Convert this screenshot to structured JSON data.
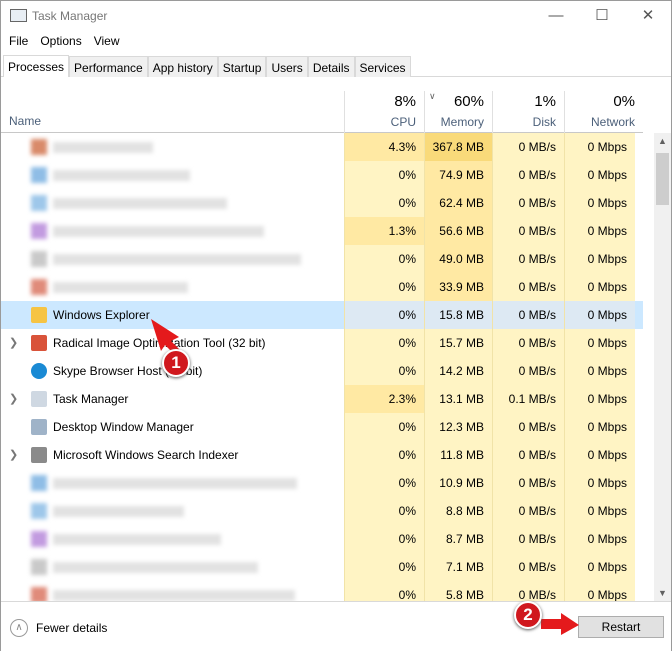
{
  "window": {
    "title": "Task Manager"
  },
  "menu": [
    "File",
    "Options",
    "View"
  ],
  "tabs": [
    "Processes",
    "Performance",
    "App history",
    "Startup",
    "Users",
    "Details",
    "Services"
  ],
  "header": {
    "name": "Name",
    "cpu": {
      "pct": "8%",
      "label": "CPU"
    },
    "memory": {
      "pct": "60%",
      "label": "Memory"
    },
    "disk": {
      "pct": "1%",
      "label": "Disk"
    },
    "network": {
      "pct": "0%",
      "label": "Network"
    }
  },
  "rows": [
    {
      "name": "",
      "cpu": "4.3%",
      "mem": "367.8 MB",
      "disk": "0 MB/s",
      "net": "0 Mbps"
    },
    {
      "name": "",
      "cpu": "0%",
      "mem": "74.9 MB",
      "disk": "0 MB/s",
      "net": "0 Mbps"
    },
    {
      "name": "",
      "cpu": "0%",
      "mem": "62.4 MB",
      "disk": "0 MB/s",
      "net": "0 Mbps"
    },
    {
      "name": "",
      "cpu": "1.3%",
      "mem": "56.6 MB",
      "disk": "0 MB/s",
      "net": "0 Mbps"
    },
    {
      "name": "",
      "cpu": "0%",
      "mem": "49.0 MB",
      "disk": "0 MB/s",
      "net": "0 Mbps"
    },
    {
      "name": "",
      "cpu": "0%",
      "mem": "33.9 MB",
      "disk": "0 MB/s",
      "net": "0 Mbps"
    },
    {
      "name": "Windows Explorer",
      "cpu": "0%",
      "mem": "15.8 MB",
      "disk": "0 MB/s",
      "net": "0 Mbps"
    },
    {
      "name": "Radical Image Optimization Tool (32 bit)",
      "cpu": "0%",
      "mem": "15.7 MB",
      "disk": "0 MB/s",
      "net": "0 Mbps"
    },
    {
      "name": "Skype Browser Host (32 bit)",
      "cpu": "0%",
      "mem": "14.2 MB",
      "disk": "0 MB/s",
      "net": "0 Mbps"
    },
    {
      "name": "Task Manager",
      "cpu": "2.3%",
      "mem": "13.1 MB",
      "disk": "0.1 MB/s",
      "net": "0 Mbps"
    },
    {
      "name": "Desktop Window Manager",
      "cpu": "0%",
      "mem": "12.3 MB",
      "disk": "0 MB/s",
      "net": "0 Mbps"
    },
    {
      "name": "Microsoft Windows Search Indexer",
      "cpu": "0%",
      "mem": "11.8 MB",
      "disk": "0 MB/s",
      "net": "0 Mbps"
    },
    {
      "name": "",
      "cpu": "0%",
      "mem": "10.9 MB",
      "disk": "0 MB/s",
      "net": "0 Mbps"
    },
    {
      "name": "",
      "cpu": "0%",
      "mem": "8.8 MB",
      "disk": "0 MB/s",
      "net": "0 Mbps"
    },
    {
      "name": "",
      "cpu": "0%",
      "mem": "8.7 MB",
      "disk": "0 MB/s",
      "net": "0 Mbps"
    },
    {
      "name": "",
      "cpu": "0%",
      "mem": "7.1 MB",
      "disk": "0 MB/s",
      "net": "0 Mbps"
    },
    {
      "name": "",
      "cpu": "0%",
      "mem": "5.8 MB",
      "disk": "0 MB/s",
      "net": "0 Mbps"
    }
  ],
  "footer": {
    "fewer_details": "Fewer details",
    "restart": "Restart"
  },
  "annotations": [
    "1",
    "2"
  ],
  "colors": {
    "selected_row": "#cce8ff",
    "heat_low": "#fff4c4",
    "heat_high": "#f9da7a",
    "badge": "#d0181e"
  }
}
